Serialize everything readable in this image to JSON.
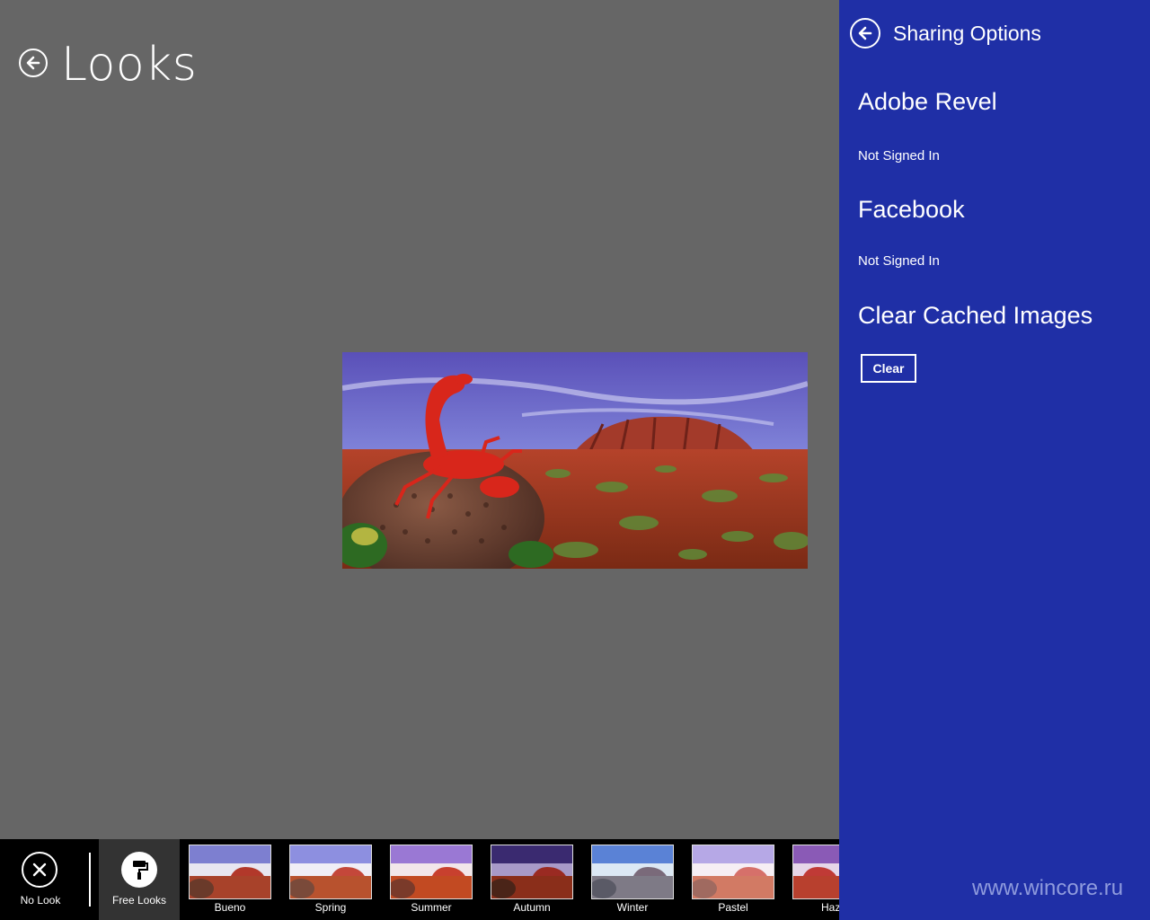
{
  "page": {
    "title": "Looks"
  },
  "looks_bar": {
    "no_look_label": "No Look",
    "free_looks_label": "Free Looks",
    "thumbnails": [
      {
        "label": "Bueno"
      },
      {
        "label": "Spring"
      },
      {
        "label": "Summer"
      },
      {
        "label": "Autumn"
      },
      {
        "label": "Winter"
      },
      {
        "label": "Pastel"
      },
      {
        "label": "Haze"
      }
    ]
  },
  "sharing_panel": {
    "title": "Sharing Options",
    "sections": [
      {
        "heading": "Adobe Revel",
        "status": "Not Signed In"
      },
      {
        "heading": "Facebook",
        "status": "Not Signed In"
      }
    ],
    "cache": {
      "heading": "Clear Cached Images",
      "button_label": "Clear"
    }
  },
  "watermark": "www.wincore.ru",
  "colors": {
    "canvas": "#666666",
    "panel": "#1f2fa6",
    "bar": "#000000"
  },
  "icons": {
    "back": "arrow-left-circle-icon",
    "no_look": "x-circle-icon",
    "free_looks": "paint-roller-icon"
  }
}
